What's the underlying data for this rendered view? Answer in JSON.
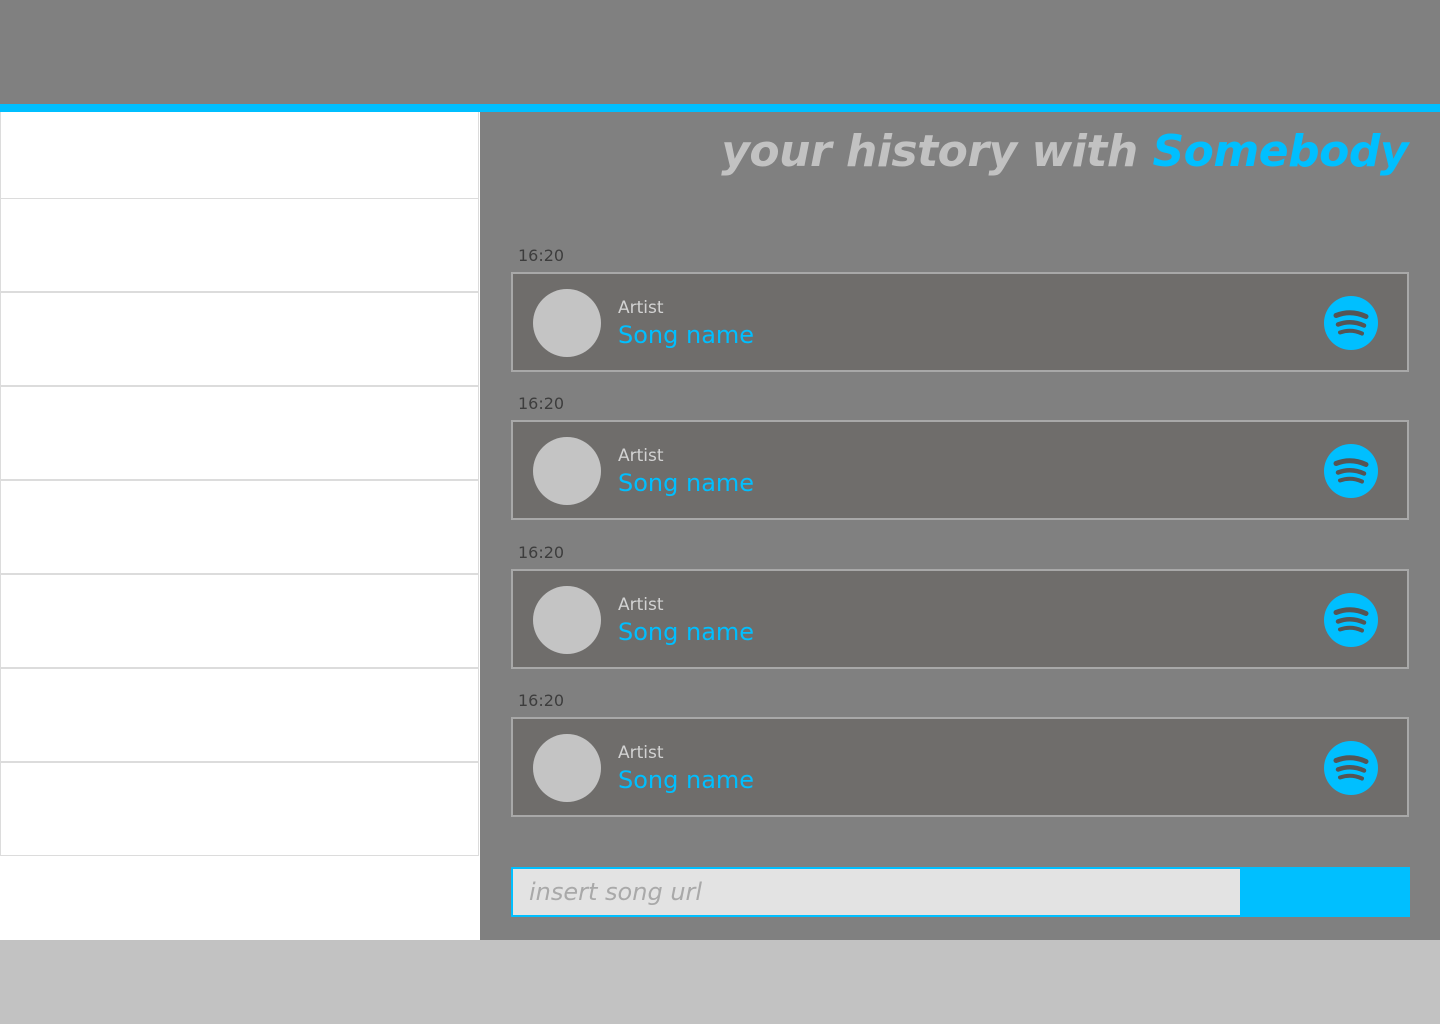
{
  "header": {},
  "sidebar": {
    "rows": [
      "",
      "",
      "",
      "",
      "",
      "",
      "",
      ""
    ]
  },
  "main": {
    "title_prefix": "your history with",
    "title_name": "Somebody",
    "history": [
      {
        "time": "16:20",
        "artist": "Artist",
        "song": "Song name",
        "service_icon": "spotify-icon"
      },
      {
        "time": "16:20",
        "artist": "Artist",
        "song": "Song name",
        "service_icon": "spotify-icon"
      },
      {
        "time": "16:20",
        "artist": "Artist",
        "song": "Song name",
        "service_icon": "spotify-icon"
      },
      {
        "time": "16:20",
        "artist": "Artist",
        "song": "Song name",
        "service_icon": "spotify-icon"
      }
    ],
    "url_input": {
      "placeholder": "insert song url",
      "value": ""
    },
    "submit_label": ""
  },
  "colors": {
    "accent": "#00bfff",
    "header_bg": "#808080",
    "panel_bg": "#808080",
    "card_bg": "#6f6d6b",
    "sidebar_bg": "#ffffff",
    "footer_bg": "#c2c2c2"
  }
}
